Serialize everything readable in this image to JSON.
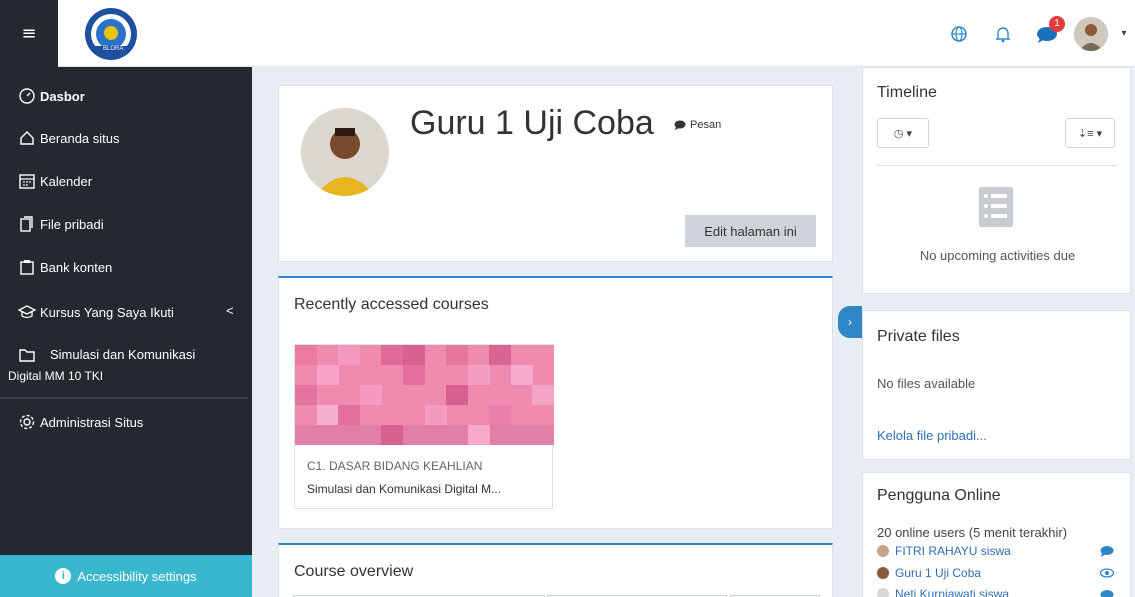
{
  "colors": {
    "sidebar_bg": "#24292f",
    "accent": "#2f86c6",
    "accessibility_bg": "#3bb6cf",
    "badge": "#e43a3a",
    "page_bg": "#e9eef4",
    "course_tile": "#f08bb0"
  },
  "navbar": {
    "menu_icon": "hamburger-icon",
    "logo_alt": "school-logo",
    "logo_text": "BLORA",
    "icons": [
      "globe-icon",
      "bell-icon",
      "chat-icon",
      "user-avatar"
    ],
    "message_badge": "1"
  },
  "sidebar": {
    "items": [
      {
        "label": "Dasbor",
        "icon": "gauge-icon"
      },
      {
        "label": "Beranda situs",
        "icon": "home-icon"
      },
      {
        "label": "Kalender",
        "icon": "calendar-icon"
      },
      {
        "label": "File pribadi",
        "icon": "file-icon"
      },
      {
        "label": "Bank konten",
        "icon": "clipboard-icon"
      },
      {
        "label": "Kursus Yang Saya Ikuti",
        "icon": "graduation-cap-icon"
      },
      {
        "label": "Simulasi dan Komunikasi",
        "label2": "Digital MM 10 TKI",
        "icon": "folder-icon"
      },
      {
        "label": "Administrasi Situs",
        "icon": "gear-icon"
      }
    ],
    "expand_glyph": "<",
    "accessibility_label": "Accessibility settings"
  },
  "profile": {
    "name": "Guru 1 Uji Coba",
    "message_label": "Pesan",
    "edit_button": "Edit halaman ini"
  },
  "recent": {
    "title": "Recently accessed courses",
    "course": {
      "category": "C1. DASAR BIDANG KEAHLIAN",
      "name": "Simulasi dan Komunikasi Digital M..."
    }
  },
  "overview": {
    "title": "Course overview"
  },
  "timeline": {
    "title": "Timeline",
    "empty_text": "No upcoming activities due"
  },
  "private_files": {
    "title": "Private files",
    "empty_text": "No files available",
    "manage_link": "Kelola file pribadi..."
  },
  "online": {
    "title": "Pengguna Online",
    "summary": "20 online users (5 menit terakhir)",
    "users": [
      {
        "name": "FITRI RAHAYU siswa",
        "action_icon": "chat-icon"
      },
      {
        "name": "Guru 1 Uji Coba",
        "action_icon": "eye-icon"
      },
      {
        "name": "Neti Kurniawati siswa",
        "action_icon": "chat-icon"
      }
    ]
  }
}
